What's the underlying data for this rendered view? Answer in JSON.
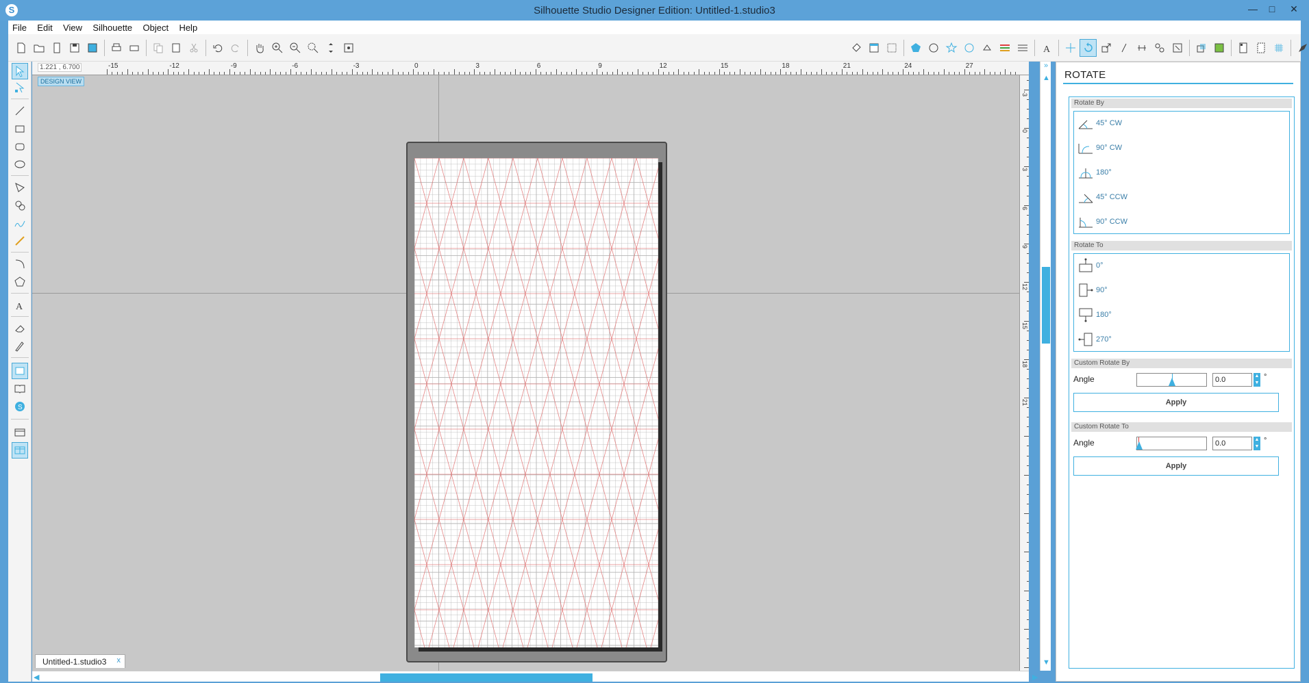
{
  "window": {
    "title": "Silhouette Studio Designer Edition: Untitled-1.studio3",
    "app_icon": "S",
    "minimize": "—",
    "maximize": "□",
    "close": "✕"
  },
  "menu": [
    "File",
    "Edit",
    "View",
    "Silhouette",
    "Object",
    "Help"
  ],
  "workspace": {
    "coordinates": "1.221 , 6.700",
    "design_view_label": "DESIGN VIEW",
    "ruler_h_labels": [
      "-15",
      "-12",
      "-9",
      "-6",
      "-3",
      "0",
      "3",
      "6",
      "9",
      "12",
      "15",
      "18",
      "21",
      "24",
      "27"
    ],
    "ruler_v_labels": [
      "-3",
      "0",
      "3",
      "6",
      "9",
      "12",
      "15",
      "18",
      "21"
    ],
    "doc_tab": "Untitled-1.studio3",
    "doc_tab_close": "x"
  },
  "rotate_panel": {
    "title": "ROTATE",
    "rotate_by": {
      "header": "Rotate By",
      "options": [
        "45° CW",
        "90° CW",
        "180°",
        "45° CCW",
        "90° CCW"
      ]
    },
    "rotate_to": {
      "header": "Rotate To",
      "options": [
        "0°",
        "90°",
        "180°",
        "270°"
      ]
    },
    "custom_rotate_by": {
      "header": "Custom Rotate By",
      "angle_label": "Angle",
      "angle_value": "0.0",
      "degree_symbol": "°",
      "apply_label": "Apply"
    },
    "custom_rotate_to": {
      "header": "Custom Rotate To",
      "angle_label": "Angle",
      "angle_value": "0.0",
      "degree_symbol": "°",
      "apply_label": "Apply"
    }
  },
  "colors": {
    "accent": "#3fb0e0",
    "grid_line": "#b5b5b5",
    "pattern_line": "#e06a6a"
  }
}
